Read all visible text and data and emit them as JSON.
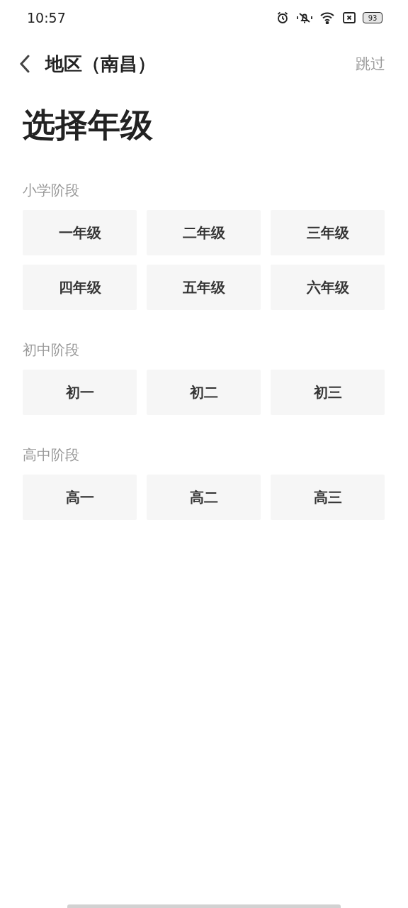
{
  "status_bar": {
    "time": "10:57",
    "battery": "93"
  },
  "header": {
    "title": "地区（南昌）",
    "skip": "跳过"
  },
  "heading": "选择年级",
  "sections": [
    {
      "label": "小学阶段",
      "grades": [
        "一年级",
        "二年级",
        "三年级",
        "四年级",
        "五年级",
        "六年级"
      ]
    },
    {
      "label": "初中阶段",
      "grades": [
        "初一",
        "初二",
        "初三"
      ]
    },
    {
      "label": "高中阶段",
      "grades": [
        "高一",
        "高二",
        "高三"
      ]
    }
  ]
}
